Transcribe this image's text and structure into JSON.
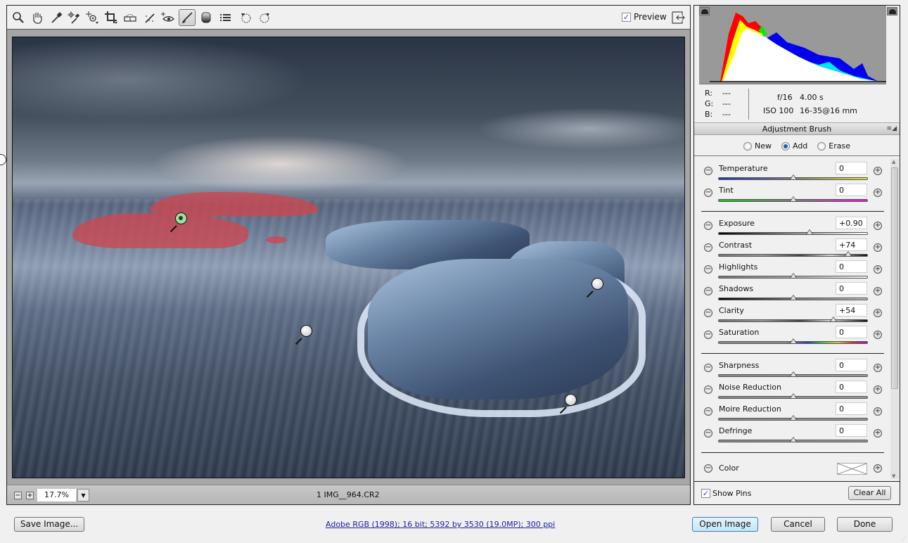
{
  "toolbar": {
    "tools": [
      {
        "name": "zoom-tool",
        "icon": "magnifier-icon"
      },
      {
        "name": "hand-tool",
        "icon": "hand-icon"
      },
      {
        "name": "white-balance-tool",
        "icon": "eyedropper-icon"
      },
      {
        "name": "color-sampler-tool",
        "icon": "color-sampler-icon"
      },
      {
        "name": "targeted-adjustment-tool",
        "icon": "target-adjust-icon"
      },
      {
        "name": "crop-tool",
        "icon": "crop-icon"
      },
      {
        "name": "straighten-tool",
        "icon": "level-icon"
      },
      {
        "name": "spot-removal-tool",
        "icon": "spot-removal-icon"
      },
      {
        "name": "red-eye-removal-tool",
        "icon": "red-eye-icon"
      },
      {
        "name": "adjustment-brush-tool",
        "icon": "brush-icon",
        "active": true
      },
      {
        "name": "graduated-filter-tool",
        "icon": "graduated-filter-icon"
      },
      {
        "name": "preferences",
        "icon": "list-icon"
      },
      {
        "name": "rotate-left",
        "icon": "rotate-ccw-icon"
      },
      {
        "name": "rotate-right",
        "icon": "rotate-cw-icon"
      }
    ],
    "preview_label": "Preview",
    "preview_checked": true
  },
  "status_bar": {
    "zoom_out": "−",
    "zoom_in": "+",
    "zoom_level": "17.7%",
    "filename": "1 IMG__964.CR2"
  },
  "readout": {
    "r_label": "R:",
    "r_value": "---",
    "g_label": "G:",
    "g_value": "---",
    "b_label": "B:",
    "b_value": "---",
    "aperture": "f/16",
    "shutter": "4.00 s",
    "iso": "ISO 100",
    "lens": "16-35@16 mm"
  },
  "panel": {
    "title": "Adjustment Brush",
    "menu_icon": "≡◢",
    "modes": [
      {
        "label": "New",
        "checked": false
      },
      {
        "label": "Add",
        "checked": true
      },
      {
        "label": "Erase",
        "checked": false
      }
    ],
    "sliders": [
      {
        "label": "Temperature",
        "value": "0",
        "position": 0.5,
        "track": "temperature"
      },
      {
        "label": "Tint",
        "value": "0",
        "position": 0.5,
        "track": "tint"
      },
      {
        "label": "Exposure",
        "value": "+0.90",
        "position": 0.6125,
        "track": "exposure"
      },
      {
        "label": "Contrast",
        "value": "+74",
        "position": 0.87,
        "track": "contrast"
      },
      {
        "label": "Highlights",
        "value": "0",
        "position": 0.5,
        "track": "highlights"
      },
      {
        "label": "Shadows",
        "value": "0",
        "position": 0.5,
        "track": "shadows"
      },
      {
        "label": "Clarity",
        "value": "+54",
        "position": 0.77,
        "track": "clarity"
      },
      {
        "label": "Saturation",
        "value": "0",
        "position": 0.5,
        "track": "saturation"
      },
      {
        "label": "Sharpness",
        "value": "0",
        "position": 0.5,
        "track": "plain"
      },
      {
        "label": "Noise Reduction",
        "value": "0",
        "position": 0.5,
        "track": "plain"
      },
      {
        "label": "Moire Reduction",
        "value": "0",
        "position": 0.5,
        "track": "plain"
      },
      {
        "label": "Defringe",
        "value": "0",
        "position": 0.5,
        "track": "plain"
      }
    ],
    "color_label": "Color",
    "show_pins_label": "Show Pins",
    "show_pins_checked": true,
    "clear_all_label": "Clear All"
  },
  "dialog": {
    "save_image_label": "Save Image...",
    "workflow_link": "Adobe RGB (1998); 16 bit; 5392 by 3530 (19.0MP); 300 ppi",
    "open_image_label": "Open Image",
    "cancel_label": "Cancel",
    "done_label": "Done"
  },
  "colors": {
    "mask_overlay": "#cd4650",
    "active_pin": "#9be39b",
    "link": "#1a1aa6",
    "histogram_bg": "#999999"
  }
}
